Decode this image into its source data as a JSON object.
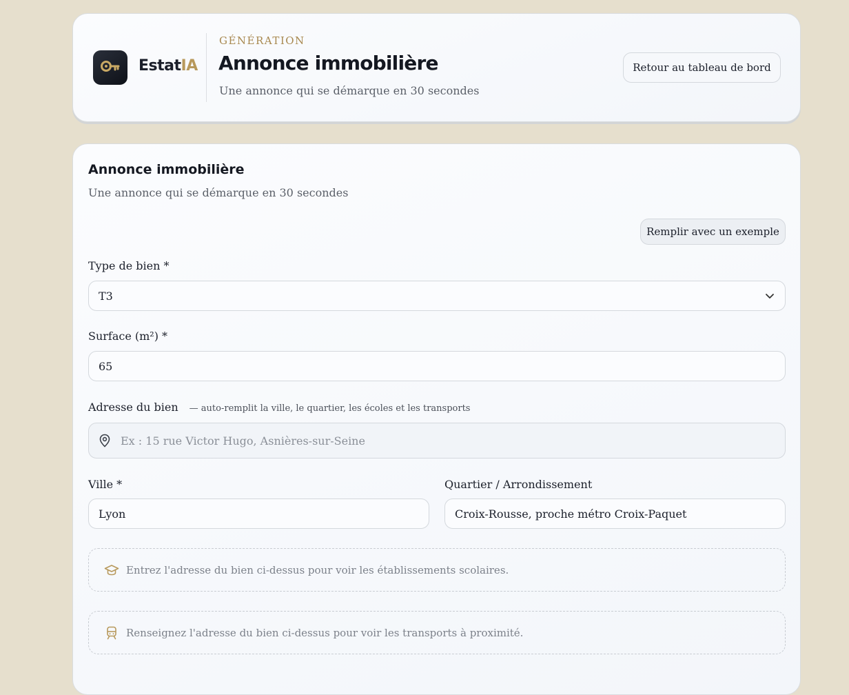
{
  "header": {
    "brand_prefix": "Estat",
    "brand_suffix": "IA",
    "eyebrow": "GÉNÉRATION",
    "title": "Annonce immobilière",
    "subtitle": "Une annonce qui se démarque en 30 secondes",
    "back_button": "Retour au tableau de bord",
    "logo_icon": "key-icon"
  },
  "form": {
    "title": "Annonce immobilière",
    "subtitle": "Une annonce qui se démarque en 30 secondes",
    "example_button": "Remplir avec un exemple",
    "type": {
      "label": "Type de bien *",
      "value": "T3"
    },
    "surface": {
      "label": "Surface (m²) *",
      "value": "65"
    },
    "address": {
      "label": "Adresse du bien",
      "hint": "— auto-remplit la ville, le quartier, les écoles et les transports",
      "placeholder": "Ex : 15 rue Victor Hugo, Asnières-sur-Seine",
      "value": ""
    },
    "city": {
      "label": "Ville *",
      "value": "Lyon"
    },
    "district": {
      "label": "Quartier / Arrondissement",
      "value": "Croix-Rousse, proche métro Croix-Paquet"
    },
    "schools_note": "Entrez l'adresse du bien ci-dessus pour voir les établissements scolaires.",
    "transport_note": "Renseignez l'adresse du bien ci-dessus pour voir les transports à proximité."
  },
  "colors": {
    "accent": "#b8995c",
    "background": "#e6dfcd"
  }
}
